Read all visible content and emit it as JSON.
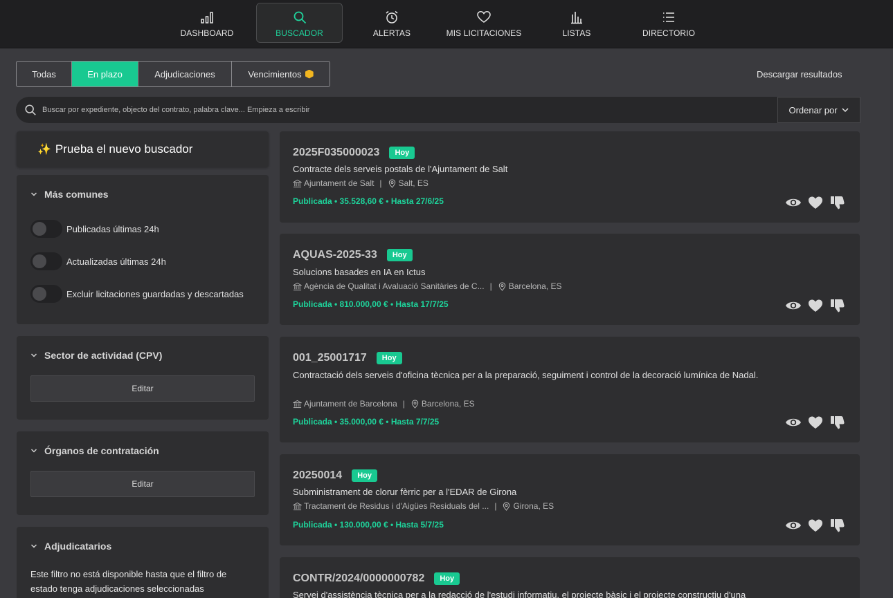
{
  "nav": [
    {
      "label": "DASHBOARD",
      "icon": "bar-chart-icon"
    },
    {
      "label": "BUSCADOR",
      "icon": "search-icon"
    },
    {
      "label": "ALERTAS",
      "icon": "alarm-clock-icon"
    },
    {
      "label": "MIS LICITACIONES",
      "icon": "heart-icon"
    },
    {
      "label": "LISTAS",
      "icon": "columns-chart-icon"
    },
    {
      "label": "DIRECTORIO",
      "icon": "list-icon"
    }
  ],
  "tabs": [
    {
      "label": "Todas"
    },
    {
      "label": "En plazo",
      "active": true
    },
    {
      "label": "Adjudicaciones"
    },
    {
      "label": "Vencimientos",
      "icon": "premium-coin-icon"
    }
  ],
  "download_label": "Descargar resultados",
  "search": {
    "placeholder": "Buscar por expediente, objecto del contrato, palabra clave... Empieza a escribir"
  },
  "order_label": "Ordenar por",
  "sidebar": {
    "try_new": {
      "icon": "✨",
      "label": "Prueba el nuevo buscador"
    },
    "common": {
      "title": "Más comunes",
      "toggles": [
        {
          "label": "Publicadas últimas 24h",
          "on": false
        },
        {
          "label": "Actualizadas últimas 24h",
          "on": false
        },
        {
          "label": "Excluir licitaciones guardadas y descartadas",
          "on": false
        }
      ]
    },
    "sector": {
      "title": "Sector de actividad (CPV)",
      "edit": "Editar"
    },
    "organos": {
      "title": "Órganos de contratación",
      "edit": "Editar"
    },
    "adjudicatarios": {
      "title": "Adjudicatarios",
      "note": "Este filtro no está disponible hasta que el filtro de estado tenga adjudicaciones seleccionadas"
    }
  },
  "colors": {
    "accent": "#19c991",
    "status_text": "#1ed49b",
    "coin": "#f2b620"
  },
  "results": [
    {
      "code": "2025F035000023",
      "badge": "Hoy",
      "title": "Contracte dels serveis postals de l'Ajuntament de Salt",
      "organ": "Ajuntament de Salt",
      "location": "Salt, ES",
      "status": "Publicada • 35.528,60 € • Hasta 27/6/25"
    },
    {
      "code": "AQUAS-2025-33",
      "badge": "Hoy",
      "title": "Solucions basades en IA en Ictus",
      "organ": "Agència de Qualitat i Avaluació Sanitàries de C...",
      "location": "Barcelona, ES",
      "status": "Publicada • 810.000,00 € • Hasta 17/7/25"
    },
    {
      "code": "001_25001717",
      "badge": "Hoy",
      "title": "Contractació dels serveis d'oficina tècnica per a la preparació, seguiment i control de la decoració lumínica de Nadal.",
      "organ": "Ajuntament de Barcelona",
      "location": "Barcelona, ES",
      "status": "Publicada • 35.000,00 € • Hasta 7/7/25"
    },
    {
      "code": "20250014",
      "badge": "Hoy",
      "title": "Subministrament de clorur fèrric per a l'EDAR de Girona",
      "organ": "Tractament de Residus i d'Aigües Residuals del ...",
      "location": "Girona, ES",
      "status": "Publicada • 130.000,00 € • Hasta 5/7/25"
    },
    {
      "code": "CONTR/2024/0000000782",
      "badge": "Hoy",
      "title": "Servei d'assistència tècnica per a la redacció de l'estudi informatiu, el projecte bàsic i el projecte constructiu d'una"
    }
  ]
}
